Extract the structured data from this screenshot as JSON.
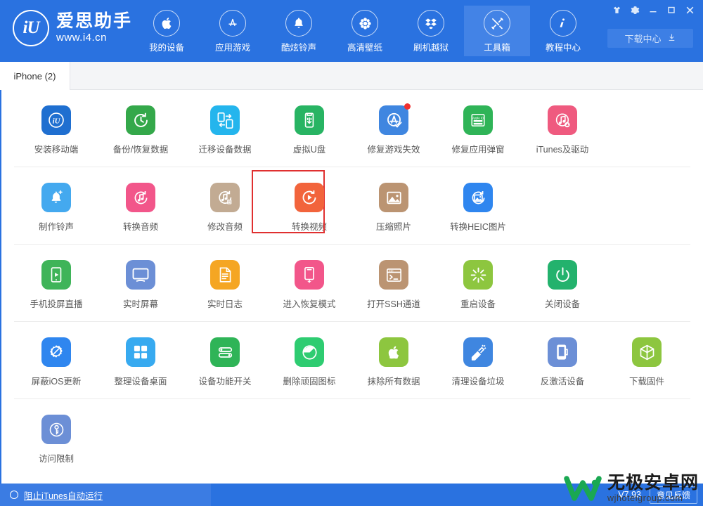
{
  "app": {
    "brand_name": "爱思助手",
    "brand_url": "www.i4.cn",
    "logo_mark": "iU",
    "version": "V7.93",
    "accent_color": "#2a72e0",
    "highlight_color": "#e03030"
  },
  "titlebar": {
    "buttons": [
      {
        "name": "skin-icon",
        "label": ""
      },
      {
        "name": "settings-gear-icon",
        "label": ""
      },
      {
        "name": "minimize-icon",
        "label": ""
      },
      {
        "name": "maximize-icon",
        "label": ""
      },
      {
        "name": "close-icon",
        "label": ""
      }
    ],
    "download_center": "下载中心"
  },
  "nav": {
    "items": [
      {
        "label": "我的设备",
        "icon": "apple-icon",
        "active": false
      },
      {
        "label": "应用游戏",
        "icon": "appstore-icon",
        "active": false
      },
      {
        "label": "酷炫铃声",
        "icon": "bell-icon",
        "active": false
      },
      {
        "label": "高清壁纸",
        "icon": "flower-icon",
        "active": false
      },
      {
        "label": "刷机越狱",
        "icon": "dropbox-icon",
        "active": false
      },
      {
        "label": "工具箱",
        "icon": "tools-icon",
        "active": true
      },
      {
        "label": "教程中心",
        "icon": "info-icon",
        "active": false
      }
    ]
  },
  "tabs": [
    {
      "label": "iPhone (2)",
      "active": true
    }
  ],
  "toolbox": {
    "rows": [
      {
        "cells": [
          {
            "label": "安装移动端",
            "icon": "i4-app-icon",
            "color": "#1f6fd0",
            "badge": false,
            "highlight": false
          },
          {
            "label": "备份/恢复数据",
            "icon": "backup-restore-icon",
            "color": "#34a84a",
            "badge": false,
            "highlight": false
          },
          {
            "label": "迁移设备数据",
            "icon": "migrate-data-icon",
            "color": "#24b5ed",
            "badge": false,
            "highlight": false
          },
          {
            "label": "虚拟U盘",
            "icon": "usb-drive-icon",
            "color": "#28b463",
            "badge": false,
            "highlight": false
          },
          {
            "label": "修复游戏失效",
            "icon": "fix-game-icon",
            "color": "#3f86e0",
            "badge": true,
            "highlight": false
          },
          {
            "label": "修复应用弹窗",
            "icon": "appleid-popup-icon",
            "color": "#2fb457",
            "badge": false,
            "highlight": false
          },
          {
            "label": "iTunes及驱动",
            "icon": "itunes-driver-icon",
            "color": "#ef5a7f",
            "badge": false,
            "highlight": false
          }
        ]
      },
      {
        "cells": [
          {
            "label": "制作铃声",
            "icon": "make-ringtone-icon",
            "color": "#44a9ef",
            "badge": false,
            "highlight": false
          },
          {
            "label": "转换音频",
            "icon": "convert-audio-icon",
            "color": "#f2568a",
            "badge": false,
            "highlight": false
          },
          {
            "label": "修改音频",
            "icon": "edit-audio-icon",
            "color": "#c2ab93",
            "badge": false,
            "highlight": false
          },
          {
            "label": "转换视频",
            "icon": "convert-video-icon",
            "color": "#f2643c",
            "badge": false,
            "highlight": true
          },
          {
            "label": "压缩照片",
            "icon": "compress-photo-icon",
            "color": "#bb9472",
            "badge": false,
            "highlight": false
          },
          {
            "label": "转换HEIC图片",
            "icon": "heic-convert-icon",
            "color": "#2f86ef",
            "badge": false,
            "highlight": false
          }
        ]
      },
      {
        "cells": [
          {
            "label": "手机投屏直播",
            "icon": "screen-cast-icon",
            "color": "#3fb459",
            "badge": false,
            "highlight": false
          },
          {
            "label": "实时屏幕",
            "icon": "live-screen-icon",
            "color": "#6c8fd6",
            "badge": false,
            "highlight": false
          },
          {
            "label": "实时日志",
            "icon": "live-log-icon",
            "color": "#f5a623",
            "badge": false,
            "highlight": false
          },
          {
            "label": "进入恢复模式",
            "icon": "recovery-mode-icon",
            "color": "#f2568a",
            "badge": false,
            "highlight": false
          },
          {
            "label": "打开SSH通道",
            "icon": "ssh-terminal-icon",
            "color": "#bb9472",
            "badge": false,
            "highlight": false
          },
          {
            "label": "重启设备",
            "icon": "reboot-icon",
            "color": "#8dc63f",
            "badge": false,
            "highlight": false
          },
          {
            "label": "关闭设备",
            "icon": "power-off-icon",
            "color": "#23b26d",
            "badge": false,
            "highlight": false
          }
        ]
      },
      {
        "cells": [
          {
            "label": "屏蔽iOS更新",
            "icon": "block-update-icon",
            "color": "#2f86ef",
            "badge": false,
            "highlight": false
          },
          {
            "label": "整理设备桌面",
            "icon": "arrange-desktop-icon",
            "color": "#37aaf0",
            "badge": false,
            "highlight": false
          },
          {
            "label": "设备功能开关",
            "icon": "feature-toggle-icon",
            "color": "#2fb457",
            "badge": false,
            "highlight": false
          },
          {
            "label": "删除顽固图标",
            "icon": "remove-icon-icon",
            "color": "#2ecc71",
            "badge": false,
            "highlight": false
          },
          {
            "label": "抹除所有数据",
            "icon": "erase-all-icon",
            "color": "#8dc63f",
            "badge": false,
            "highlight": false
          },
          {
            "label": "清理设备垃圾",
            "icon": "clean-junk-icon",
            "color": "#3f86e0",
            "badge": false,
            "highlight": false
          },
          {
            "label": "反激活设备",
            "icon": "deactivate-icon",
            "color": "#6c8fd6",
            "badge": false,
            "highlight": false
          },
          {
            "label": "下载固件",
            "icon": "download-firmware-icon",
            "color": "#8dc63f",
            "badge": false,
            "highlight": false
          }
        ]
      },
      {
        "cells": [
          {
            "label": "访问限制",
            "icon": "access-restriction-icon",
            "color": "#6c8fd6",
            "badge": false,
            "highlight": false
          }
        ]
      }
    ]
  },
  "footer": {
    "block_itunes": "阻止iTunes自动运行",
    "version": "V7.93",
    "feedback": "意见反馈"
  },
  "watermark": {
    "cn": "无极安卓网",
    "en": "wjhotelgroup.com"
  }
}
